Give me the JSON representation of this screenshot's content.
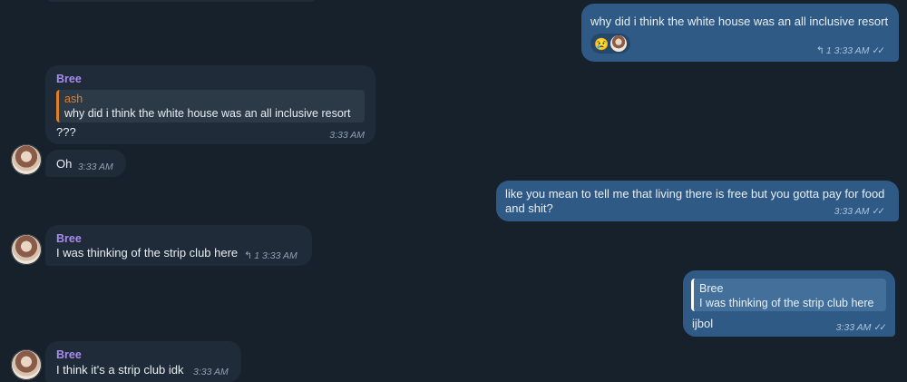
{
  "messages": {
    "out1": {
      "text": "why did i think the white house was an all inclusive resort",
      "replies": "1",
      "time": "3:33 AM",
      "reaction_emoji": "😢"
    },
    "in1": {
      "sender": "Bree",
      "quote_name": "ash",
      "quote_text": "why did i think the white house was an all inclusive resort",
      "text": "???",
      "time": "3:33 AM"
    },
    "in2": {
      "text": "Oh",
      "time": "3:33 AM"
    },
    "out2": {
      "line1": "like you mean to tell me that living there is free but you gotta pay for food",
      "line2": "and shit?",
      "time": "3:33 AM"
    },
    "in3": {
      "sender": "Bree",
      "text": "I was thinking of the strip club here",
      "replies": "1",
      "time": "3:33 AM"
    },
    "out3": {
      "quote_name": "Bree",
      "quote_text": "I was thinking of the strip club here",
      "text": "ijbol",
      "time": "3:33 AM"
    },
    "in4": {
      "sender": "Bree",
      "text": "I think it's a strip club idk",
      "time": "3:33 AM"
    }
  },
  "icons": {
    "reply": "reply-arrow-icon",
    "read": "double-check-icon"
  }
}
